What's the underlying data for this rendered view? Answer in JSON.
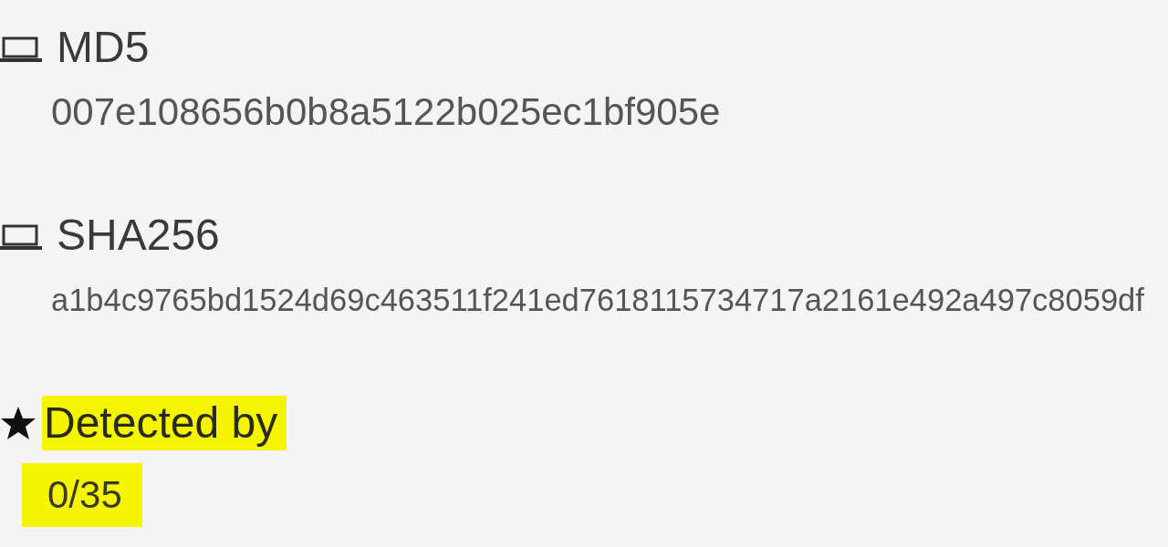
{
  "fields": [
    {
      "kind": "computer",
      "label": "MD5",
      "value": "007e108656b0b8a5122b025ec1bf905e",
      "highlighted": false
    },
    {
      "kind": "computer",
      "label": "SHA256",
      "value": "a1b4c9765bd1524d69c463511f241ed7618115734717a2161e492a497c8059df",
      "highlighted": false
    },
    {
      "kind": "star",
      "label": "Detected by",
      "value": "0/35",
      "highlighted": true
    }
  ]
}
